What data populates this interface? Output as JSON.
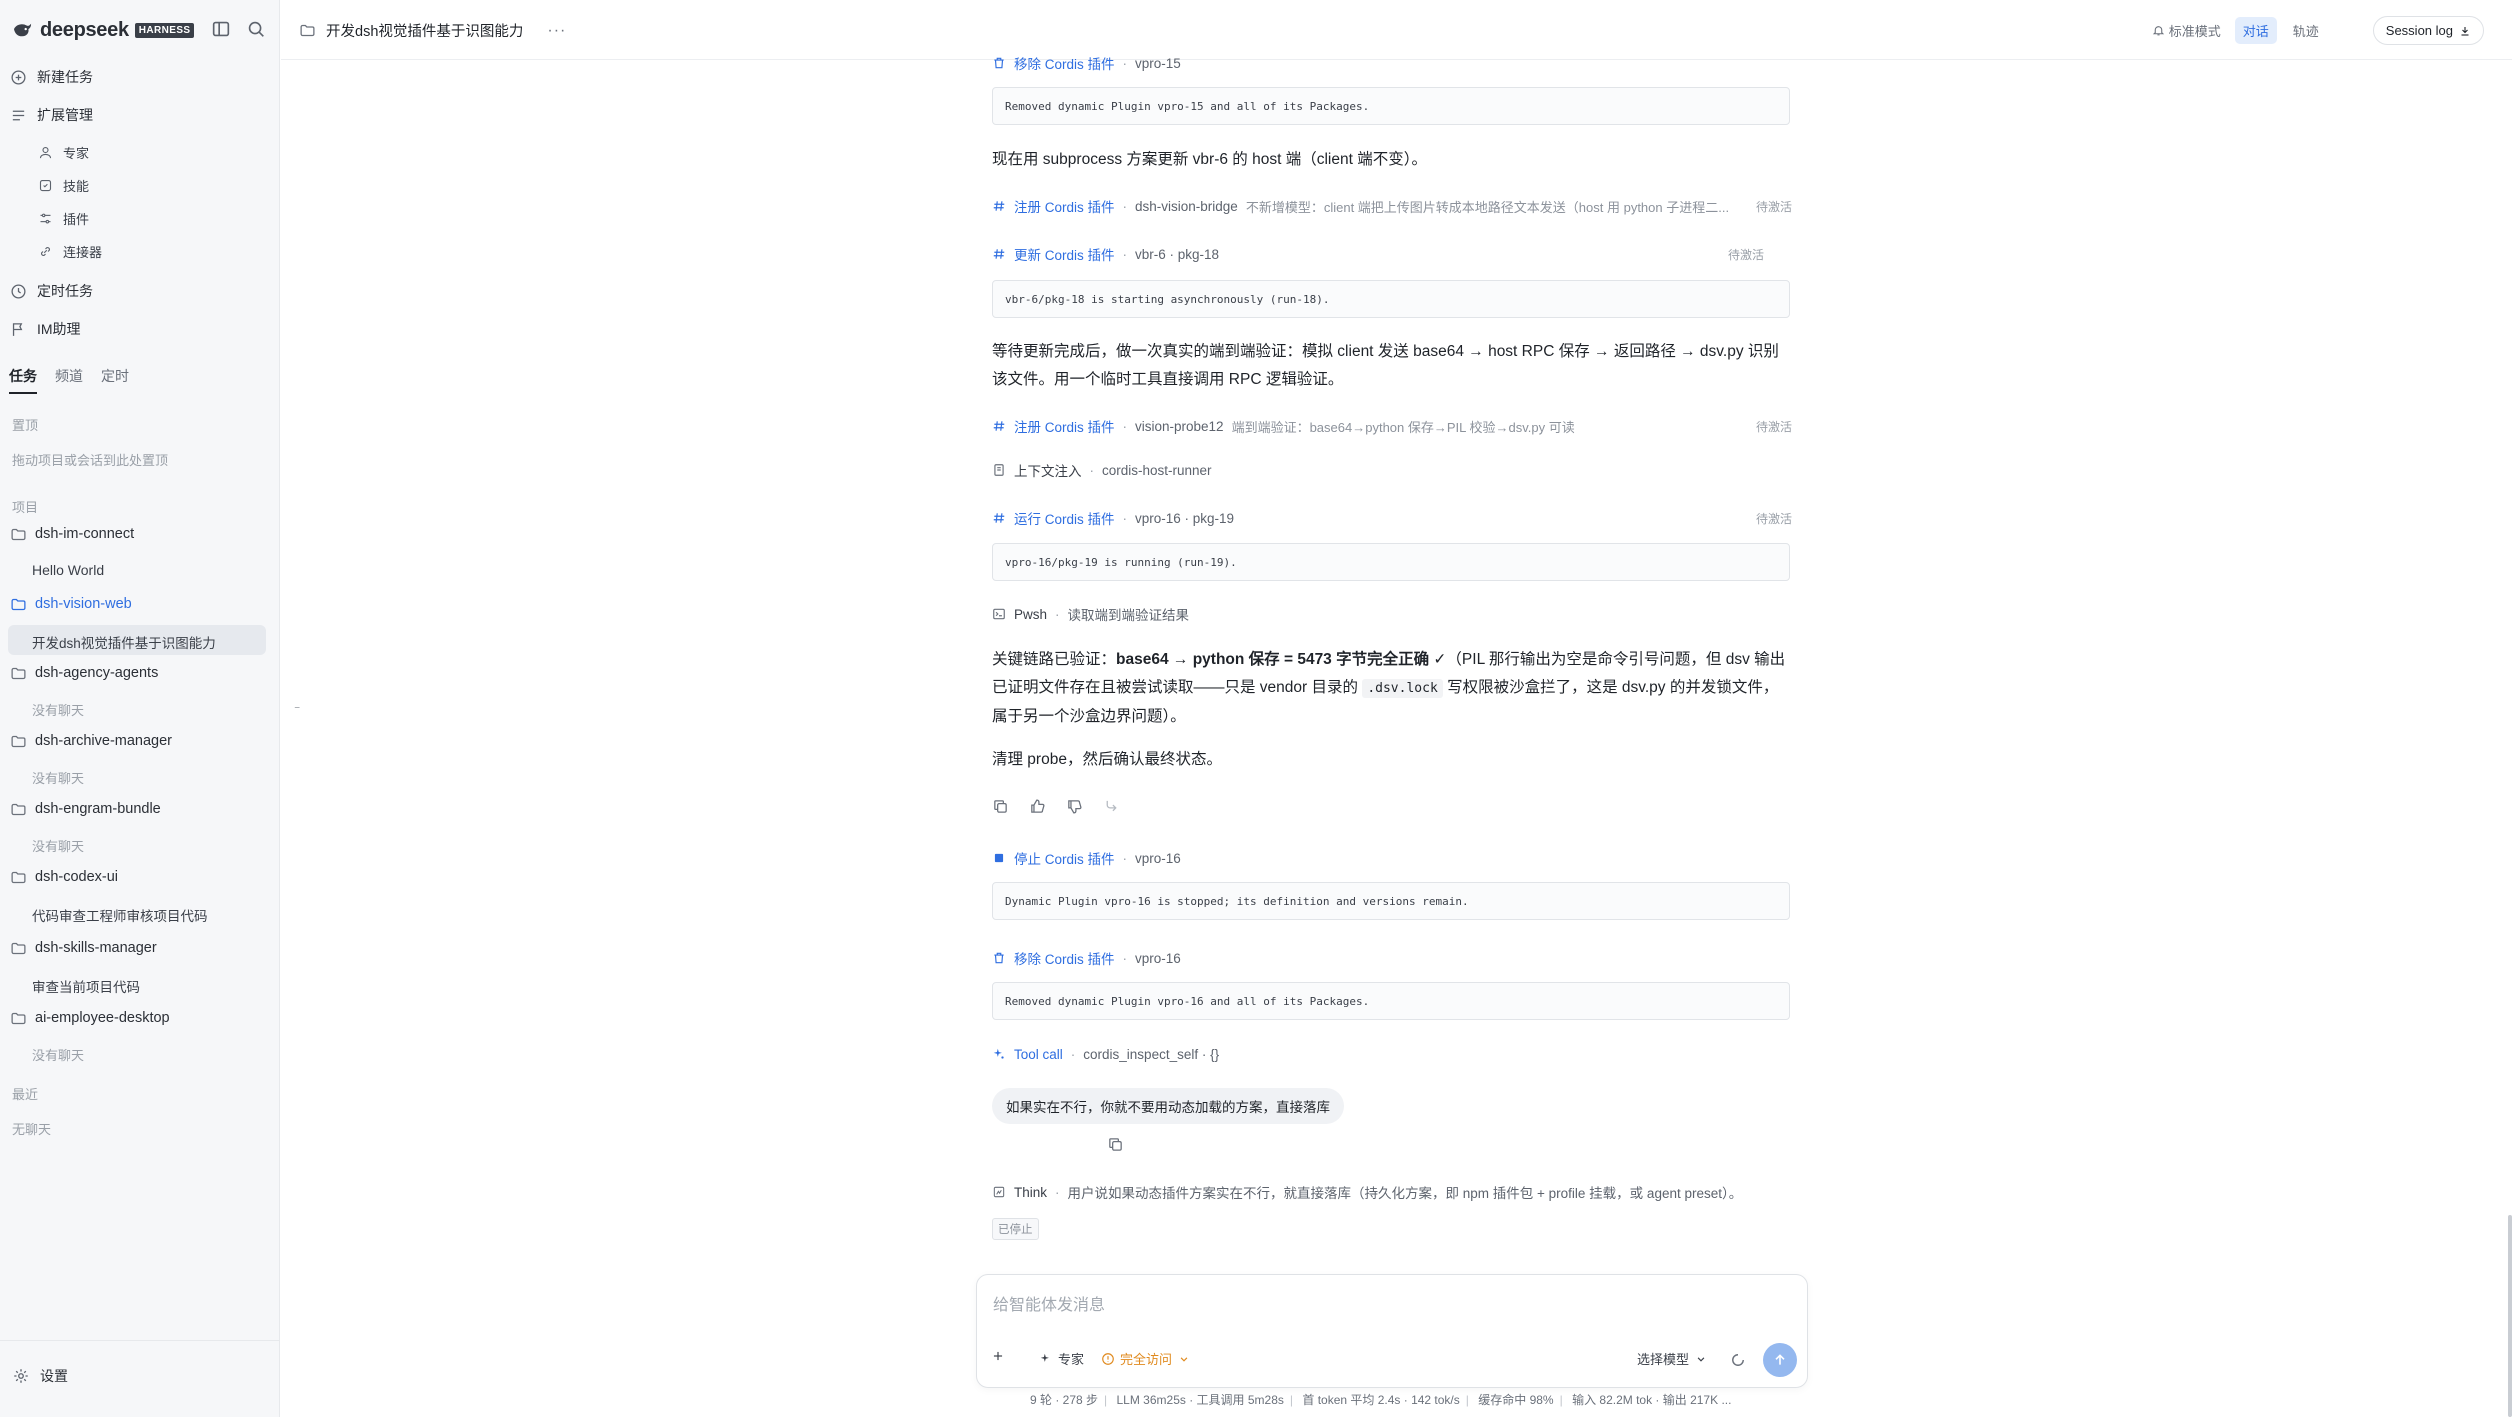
{
  "brand": {
    "name": "deepseek",
    "badge": "HARNESS"
  },
  "sidebar": {
    "nav": [
      {
        "label": "新建任务",
        "icon": "plus-circle-icon"
      },
      {
        "label": "扩展管理",
        "icon": "list-icon"
      }
    ],
    "ext_items": [
      {
        "label": "专家",
        "icon": "user-icon"
      },
      {
        "label": "技能",
        "icon": "skill-icon"
      },
      {
        "label": "插件",
        "icon": "sliders-icon"
      },
      {
        "label": "连接器",
        "icon": "link-icon"
      }
    ],
    "nav2": [
      {
        "label": "定时任务",
        "icon": "clock-icon"
      },
      {
        "label": "IM助理",
        "icon": "flag-icon"
      }
    ],
    "tabs": [
      "任务",
      "频道",
      "定时"
    ],
    "pinned_label": "置顶",
    "pinned_hint": "拖动项目或会话到此处置顶",
    "projects_label": "项目",
    "projects": [
      {
        "name": "dsh-im-connect",
        "chats": [
          "Hello World"
        ]
      },
      {
        "name": "dsh-vision-web",
        "chats": [
          "开发dsh视觉插件基于识图能力"
        ]
      },
      {
        "name": "dsh-agency-agents",
        "chats": [
          "没有聊天"
        ]
      },
      {
        "name": "dsh-archive-manager",
        "chats": [
          "没有聊天"
        ]
      },
      {
        "name": "dsh-engram-bundle",
        "chats": [
          "没有聊天"
        ]
      },
      {
        "name": "dsh-codex-ui",
        "chats": [
          "代码审查工程师审核项目代码"
        ]
      },
      {
        "name": "dsh-skills-manager",
        "chats": [
          "审查当前项目代码"
        ]
      },
      {
        "name": "ai-employee-desktop",
        "chats": [
          "没有聊天"
        ]
      }
    ],
    "recent_label": "最近",
    "recent_hint": "无聊天",
    "settings": "设置"
  },
  "header": {
    "title": "开发dsh视觉插件基于识图能力",
    "more": "···",
    "mode": "标准模式",
    "seg": [
      "对话",
      "轨迹"
    ],
    "session_log": "Session log"
  },
  "messages": {
    "t0": {
      "name": "移除 Cordis 插件",
      "arg": "vpro-15"
    },
    "o0": "Removed dynamic Plugin vpro-15 and all of its Packages.",
    "p1": "现在用 subprocess 方案更新 vbr-6 的 host 端（client 端不变）。",
    "t1": {
      "name": "注册 Cordis 插件",
      "arg": "dsh-vision-bridge",
      "desc": "不新增模型：client 端把上传图片转成本地路径文本发送（host 用 python 子进程二...",
      "status": "待激活"
    },
    "t2": {
      "name": "更新 Cordis 插件",
      "arg": "vbr-6 · pkg-18",
      "status": "待激活"
    },
    "o2": "vbr-6/pkg-18 is starting asynchronously (run-18).",
    "p2": "等待更新完成后，做一次真实的端到端验证：模拟 client 发送 base64 → host RPC 保存 → 返回路径 → dsv.py 识别该文件。用一个临时工具直接调用 RPC 逻辑验证。",
    "t3": {
      "name": "注册 Cordis 插件",
      "arg": "vision-probe12",
      "desc": "端到端验证：base64→python 保存→PIL 校验→dsv.py 可读",
      "status": "待激活"
    },
    "t4": {
      "name": "上下文注入",
      "arg": "cordis-host-runner"
    },
    "t5": {
      "name": "运行 Cordis 插件",
      "arg": "vpro-16 · pkg-19",
      "status": "待激活"
    },
    "o5": "vpro-16/pkg-19 is running (run-19).",
    "t6": {
      "name": "Pwsh",
      "arg": "读取端到端验证结果"
    },
    "p3a": "关键链路已验证：",
    "p3b": "base64 → python 保存 = 5473 字节完全正确",
    "p3c": " ✓（PIL 那行输出为空是命令引号问题，但 dsv 输出已证明文件存在且被尝试读取——只是 vendor 目录的 ",
    "p3code": ".dsv.lock",
    "p3d": " 写权限被沙盒拦了，这是 dsv.py 的并发锁文件，属于另一个沙盒边界问题）。",
    "p4": "清理 probe，然后确认最终状态。",
    "t7": {
      "name": "停止 Cordis 插件",
      "arg": "vpro-16"
    },
    "o7": "Dynamic Plugin vpro-16 is stopped; its definition and versions remain.",
    "t8": {
      "name": "移除 Cordis 插件",
      "arg": "vpro-16"
    },
    "o8": "Removed dynamic Plugin vpro-16 and all of its Packages.",
    "t9": {
      "name": "Tool call",
      "arg": "cordis_inspect_self · {}"
    },
    "user": "如果实在不行，你就不要用动态加载的方案，直接落库",
    "think_name": "Think",
    "think": "用户说如果动态插件方案实在不行，就直接落库（持久化方案，即 npm 插件包 + profile 挂载，或 agent preset）。",
    "stopped": "已停止"
  },
  "composer": {
    "placeholder": "给智能体发消息",
    "expert": "专家",
    "access": "完全访问",
    "model": "选择模型"
  },
  "stats": [
    "9 轮 · 278 步",
    "LLM 36m25s · 工具调用 5m28s",
    "首 token 平均 2.4s · 142 tok/s",
    "缓存命中 98%",
    "输入 82.2M tok · 输出 217K ..."
  ],
  "colors": {
    "accent": "#2f6ee0",
    "sidebar_bg": "#f6f7f9",
    "send": "#94b8ef",
    "access_warn": "#e08a1e"
  }
}
